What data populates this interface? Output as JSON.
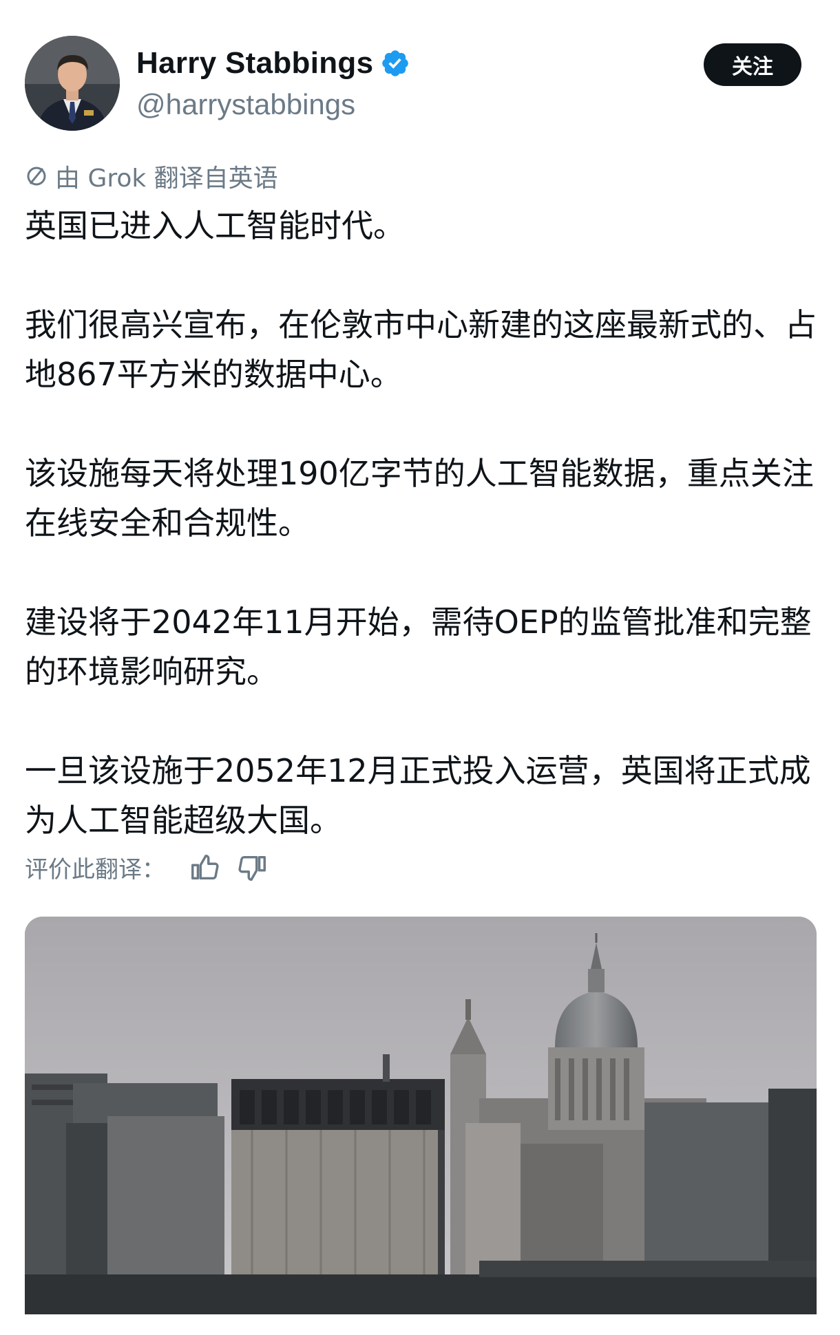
{
  "author": {
    "display_name": "Harry Stabbings",
    "handle": "@harrystabbings",
    "verified_color": "#1d9bf0"
  },
  "follow_button": {
    "label": "关注"
  },
  "translation": {
    "label": "由 Grok 翻译自英语"
  },
  "tweet": {
    "paragraphs": [
      "英国已进入人工智能时代。",
      "我们很高兴宣布，在伦敦市中心新建的这座最新式的、占地867平方米的数据中心。",
      "该设施每天将处理190亿字节的人工智能数据，重点关注在线安全和合规性。",
      "建设将于2042年11月开始，需待OEP的监管批准和完整的环境影响研究。",
      "一旦该设施于2052年12月正式投入运营，英国将正式成为人工智能超级大国。"
    ]
  },
  "rate_translation": {
    "label": "评价此翻译：",
    "thumbs_up_icon": "thumbs-up-icon",
    "thumbs_down_icon": "thumbs-down-icon"
  },
  "media": {
    "subject": "london-skyline-photo"
  },
  "colors": {
    "text": "#0f1419",
    "secondary": "#6b7a86",
    "button_bg": "#0f1419",
    "button_text": "#ffffff"
  }
}
